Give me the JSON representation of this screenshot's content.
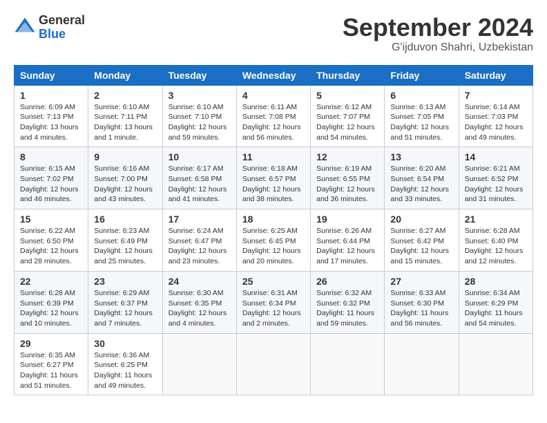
{
  "header": {
    "logo_general": "General",
    "logo_blue": "Blue",
    "month_title": "September 2024",
    "location": "G'ijduvon Shahri, Uzbekistan"
  },
  "calendar": {
    "headers": [
      "Sunday",
      "Monday",
      "Tuesday",
      "Wednesday",
      "Thursday",
      "Friday",
      "Saturday"
    ],
    "weeks": [
      [
        {
          "day": "",
          "info": ""
        },
        {
          "day": "2",
          "info": "Sunrise: 6:10 AM\nSunset: 7:11 PM\nDaylight: 13 hours\nand 1 minute."
        },
        {
          "day": "3",
          "info": "Sunrise: 6:10 AM\nSunset: 7:10 PM\nDaylight: 12 hours\nand 59 minutes."
        },
        {
          "day": "4",
          "info": "Sunrise: 6:11 AM\nSunset: 7:08 PM\nDaylight: 12 hours\nand 56 minutes."
        },
        {
          "day": "5",
          "info": "Sunrise: 6:12 AM\nSunset: 7:07 PM\nDaylight: 12 hours\nand 54 minutes."
        },
        {
          "day": "6",
          "info": "Sunrise: 6:13 AM\nSunset: 7:05 PM\nDaylight: 12 hours\nand 51 minutes."
        },
        {
          "day": "7",
          "info": "Sunrise: 6:14 AM\nSunset: 7:03 PM\nDaylight: 12 hours\nand 49 minutes."
        }
      ],
      [
        {
          "day": "1",
          "info": "Sunrise: 6:09 AM\nSunset: 7:13 PM\nDaylight: 13 hours\nand 4 minutes."
        },
        {
          "day": "",
          "info": ""
        },
        {
          "day": "",
          "info": ""
        },
        {
          "day": "",
          "info": ""
        },
        {
          "day": "",
          "info": ""
        },
        {
          "day": "",
          "info": ""
        },
        {
          "day": "",
          "info": ""
        }
      ],
      [
        {
          "day": "8",
          "info": "Sunrise: 6:15 AM\nSunset: 7:02 PM\nDaylight: 12 hours\nand 46 minutes."
        },
        {
          "day": "9",
          "info": "Sunrise: 6:16 AM\nSunset: 7:00 PM\nDaylight: 12 hours\nand 43 minutes."
        },
        {
          "day": "10",
          "info": "Sunrise: 6:17 AM\nSunset: 6:58 PM\nDaylight: 12 hours\nand 41 minutes."
        },
        {
          "day": "11",
          "info": "Sunrise: 6:18 AM\nSunset: 6:57 PM\nDaylight: 12 hours\nand 38 minutes."
        },
        {
          "day": "12",
          "info": "Sunrise: 6:19 AM\nSunset: 6:55 PM\nDaylight: 12 hours\nand 36 minutes."
        },
        {
          "day": "13",
          "info": "Sunrise: 6:20 AM\nSunset: 6:54 PM\nDaylight: 12 hours\nand 33 minutes."
        },
        {
          "day": "14",
          "info": "Sunrise: 6:21 AM\nSunset: 6:52 PM\nDaylight: 12 hours\nand 31 minutes."
        }
      ],
      [
        {
          "day": "15",
          "info": "Sunrise: 6:22 AM\nSunset: 6:50 PM\nDaylight: 12 hours\nand 28 minutes."
        },
        {
          "day": "16",
          "info": "Sunrise: 6:23 AM\nSunset: 6:49 PM\nDaylight: 12 hours\nand 25 minutes."
        },
        {
          "day": "17",
          "info": "Sunrise: 6:24 AM\nSunset: 6:47 PM\nDaylight: 12 hours\nand 23 minutes."
        },
        {
          "day": "18",
          "info": "Sunrise: 6:25 AM\nSunset: 6:45 PM\nDaylight: 12 hours\nand 20 minutes."
        },
        {
          "day": "19",
          "info": "Sunrise: 6:26 AM\nSunset: 6:44 PM\nDaylight: 12 hours\nand 17 minutes."
        },
        {
          "day": "20",
          "info": "Sunrise: 6:27 AM\nSunset: 6:42 PM\nDaylight: 12 hours\nand 15 minutes."
        },
        {
          "day": "21",
          "info": "Sunrise: 6:28 AM\nSunset: 6:40 PM\nDaylight: 12 hours\nand 12 minutes."
        }
      ],
      [
        {
          "day": "22",
          "info": "Sunrise: 6:28 AM\nSunset: 6:39 PM\nDaylight: 12 hours\nand 10 minutes."
        },
        {
          "day": "23",
          "info": "Sunrise: 6:29 AM\nSunset: 6:37 PM\nDaylight: 12 hours\nand 7 minutes."
        },
        {
          "day": "24",
          "info": "Sunrise: 6:30 AM\nSunset: 6:35 PM\nDaylight: 12 hours\nand 4 minutes."
        },
        {
          "day": "25",
          "info": "Sunrise: 6:31 AM\nSunset: 6:34 PM\nDaylight: 12 hours\nand 2 minutes."
        },
        {
          "day": "26",
          "info": "Sunrise: 6:32 AM\nSunset: 6:32 PM\nDaylight: 11 hours\nand 59 minutes."
        },
        {
          "day": "27",
          "info": "Sunrise: 6:33 AM\nSunset: 6:30 PM\nDaylight: 11 hours\nand 56 minutes."
        },
        {
          "day": "28",
          "info": "Sunrise: 6:34 AM\nSunset: 6:29 PM\nDaylight: 11 hours\nand 54 minutes."
        }
      ],
      [
        {
          "day": "29",
          "info": "Sunrise: 6:35 AM\nSunset: 6:27 PM\nDaylight: 11 hours\nand 51 minutes."
        },
        {
          "day": "30",
          "info": "Sunrise: 6:36 AM\nSunset: 6:25 PM\nDaylight: 11 hours\nand 49 minutes."
        },
        {
          "day": "",
          "info": ""
        },
        {
          "day": "",
          "info": ""
        },
        {
          "day": "",
          "info": ""
        },
        {
          "day": "",
          "info": ""
        },
        {
          "day": "",
          "info": ""
        }
      ]
    ]
  }
}
